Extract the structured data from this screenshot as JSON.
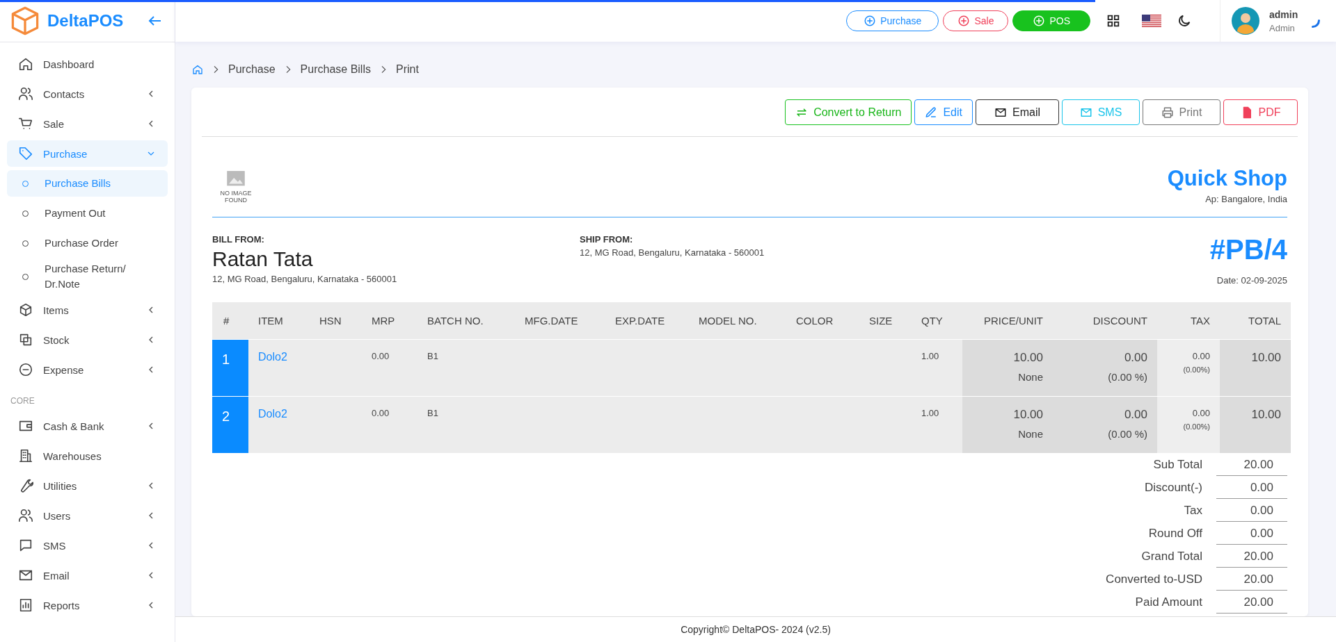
{
  "loading_bar": {
    "level": 0.82
  },
  "brand": {
    "name": "DeltaPOS"
  },
  "sidebar": {
    "sections": [
      {
        "items": [
          {
            "label": "Dashboard",
            "selected": false
          },
          {
            "label": "Contacts",
            "selected": false,
            "expanded": false
          },
          {
            "label": "Sale",
            "selected": false,
            "expanded": false
          },
          {
            "label": "Purchase",
            "selected": true,
            "expanded": true,
            "children": [
              {
                "label": "Purchase Bills",
                "selected": true
              },
              {
                "label": "Payment Out",
                "selected": false
              },
              {
                "label": "Purchase Order",
                "selected": false
              },
              {
                "label": "Purchase Return/ Dr.Note",
                "selected": false
              }
            ]
          },
          {
            "label": "Items",
            "selected": false,
            "expanded": false
          },
          {
            "label": "Stock",
            "selected": false,
            "expanded": false
          },
          {
            "label": "Expense",
            "selected": false,
            "expanded": false
          }
        ]
      },
      {
        "title": "CORE",
        "items": [
          {
            "label": "Cash & Bank",
            "selected": false,
            "expanded": false
          },
          {
            "label": "Warehouses",
            "selected": false
          },
          {
            "label": "Utilities",
            "selected": false,
            "expanded": false
          },
          {
            "label": "Users",
            "selected": false,
            "expanded": false
          },
          {
            "label": "SMS",
            "selected": false,
            "expanded": false
          },
          {
            "label": "Email",
            "selected": false,
            "expanded": false
          },
          {
            "label": "Reports",
            "selected": false,
            "expanded": false
          }
        ]
      }
    ]
  },
  "header": {
    "quick_buttons": [
      {
        "label": "Purchase",
        "kind": "primary"
      },
      {
        "label": "Sale",
        "kind": "danger"
      },
      {
        "label": "POS",
        "kind": "success"
      }
    ],
    "user": {
      "name": "admin",
      "role": "Admin"
    }
  },
  "breadcrumb": [
    "Purchase",
    "Purchase Bills",
    "Print"
  ],
  "toolbar": [
    {
      "label": "Convert to Return",
      "kind": "success"
    },
    {
      "label": "Edit",
      "kind": "primary"
    },
    {
      "label": "Email",
      "kind": "dark"
    },
    {
      "label": "SMS",
      "kind": "info"
    },
    {
      "label": "Print",
      "kind": "secondary"
    },
    {
      "label": "PDF",
      "kind": "danger"
    }
  ],
  "invoice": {
    "logo_text": "NO IMAGE FOUND",
    "shop_name": "Quick Shop",
    "shop_address": "Ap: Bangalore, India",
    "bill_from": {
      "heading": "BILL FROM:",
      "name": "Ratan Tata",
      "address": "12, MG Road, Bengaluru, Karnataka - 560001"
    },
    "ship_from": {
      "heading": "SHIP FROM:",
      "address": "12, MG Road, Bengaluru, Karnataka - 560001"
    },
    "number": "#PB/4",
    "date": "Date: 02-09-2025",
    "columns": [
      "#",
      "ITEM",
      "HSN",
      "MRP",
      "BATCH NO.",
      "MFG.DATE",
      "EXP.DATE",
      "MODEL NO.",
      "COLOR",
      "SIZE",
      "QTY",
      "PRICE/UNIT",
      "DISCOUNT",
      "TAX",
      "TOTAL"
    ],
    "rows": [
      {
        "no": "1",
        "item": "Dolo2",
        "mrp": "0.00",
        "batch": "B1",
        "qty": "1.00",
        "price": "10.00",
        "price_note": "None",
        "discount": "0.00",
        "discount_pct": "(0.00 %)",
        "tax": "0.00",
        "tax_pct": "(0.00%)",
        "total": "10.00"
      },
      {
        "no": "2",
        "item": "Dolo2",
        "mrp": "0.00",
        "batch": "B1",
        "qty": "1.00",
        "price": "10.00",
        "price_note": "None",
        "discount": "0.00",
        "discount_pct": "(0.00 %)",
        "tax": "0.00",
        "tax_pct": "(0.00%)",
        "total": "10.00"
      }
    ],
    "totals": [
      {
        "label": "Sub Total",
        "value": "20.00"
      },
      {
        "label": "Discount(-)",
        "value": "0.00"
      },
      {
        "label": "Tax",
        "value": "0.00"
      },
      {
        "label": "Round Off",
        "value": "0.00"
      },
      {
        "label": "Grand Total",
        "value": "20.00"
      },
      {
        "label": "Converted to-USD",
        "value": "20.00"
      },
      {
        "label": "Paid Amount",
        "value": "20.00"
      }
    ]
  },
  "footer": "Copyright© DeltaPOS- 2024 (v2.5)"
}
